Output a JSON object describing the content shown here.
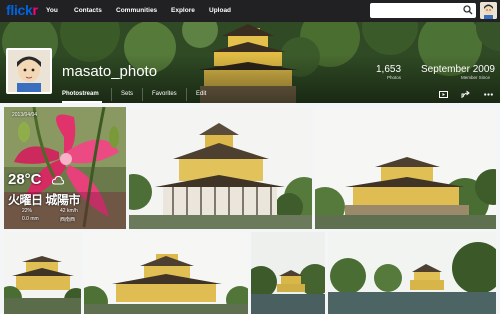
{
  "nav": {
    "logo_part1": "flick",
    "logo_part2": "r",
    "items": [
      "You",
      "Contacts",
      "Communities",
      "Explore",
      "Upload"
    ],
    "search_placeholder": ""
  },
  "profile": {
    "username": "masato_photo",
    "photos_count": "1,653",
    "photos_label": "Photos",
    "member_since": "September 2009",
    "member_since_label": "Member Since"
  },
  "subnav": {
    "items": [
      "Photostream",
      "Sets",
      "Favorites",
      "Edit"
    ],
    "active": "Photostream"
  },
  "weather_tile": {
    "date": "2013/04/04",
    "temperature": "28°C",
    "day_place": "火曜日 城陽市",
    "detail1": "22%",
    "detail2": "42 km/h",
    "detail3": "0.0 mm",
    "detail4": "西南西"
  },
  "photos": [
    {
      "id": "photo-weather-flower"
    },
    {
      "id": "photo-kinkakuji-1"
    },
    {
      "id": "photo-kinkakuji-2"
    },
    {
      "id": "photo-kinkakuji-3"
    },
    {
      "id": "photo-kinkakuji-4"
    },
    {
      "id": "photo-kinkakuji-5"
    },
    {
      "id": "photo-kinkakuji-6"
    }
  ],
  "colors": {
    "topnav_bg": "#212124",
    "logo_blue": "#0063dc",
    "logo_pink": "#ff0084",
    "page_bg": "#f3f5f6"
  }
}
